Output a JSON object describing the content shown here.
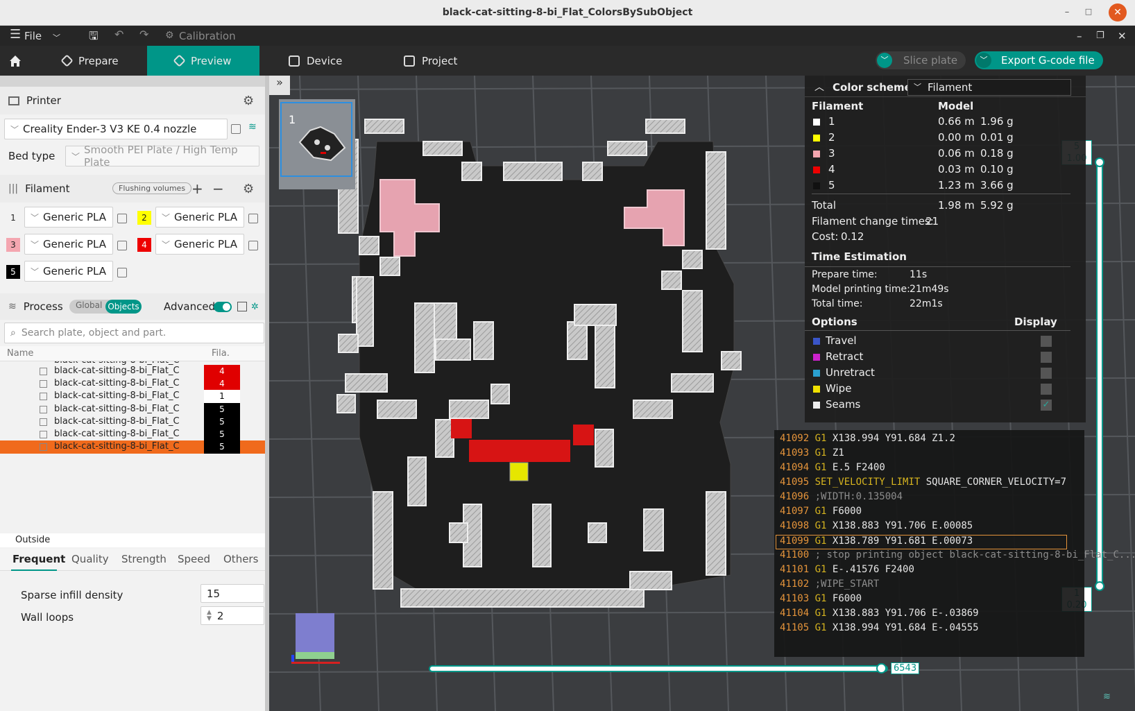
{
  "window": {
    "title": "black-cat-sitting-8-bi_Flat_ColorsBySubObject"
  },
  "menubar": {
    "file": "File",
    "calibration": "Calibration"
  },
  "tabs": [
    {
      "label": "Prepare"
    },
    {
      "label": "Preview"
    },
    {
      "label": "Device"
    },
    {
      "label": "Project"
    }
  ],
  "actions": {
    "slice": "Slice plate",
    "export": "Export G-code file"
  },
  "printer": {
    "header": "Printer",
    "name": "Creality Ender-3 V3 KE 0.4 nozzle",
    "bed_label": "Bed type",
    "bed_value": "Smooth PEI Plate / High Temp Plate"
  },
  "filament": {
    "header": "Filament",
    "flushing": "Flushing volumes",
    "slots": [
      {
        "num": "1",
        "name": "Generic PLA",
        "color": "#ffffff",
        "text_color": "#222222"
      },
      {
        "num": "2",
        "name": "Generic PLA",
        "color": "#ffff00",
        "text_color": "#222222"
      },
      {
        "num": "3",
        "name": "Generic PLA",
        "color": "#f4a6b0",
        "text_color": "#222222"
      },
      {
        "num": "4",
        "name": "Generic PLA",
        "color": "#ee0000",
        "text_color": "#ffffff"
      },
      {
        "num": "5",
        "name": "Generic PLA",
        "color": "#000000",
        "text_color": "#ffffff"
      }
    ]
  },
  "process": {
    "header": "Process",
    "global": "Global",
    "objects": "Objects",
    "advanced": "Advanced",
    "search_placeholder": "Search plate, object and part."
  },
  "object_list": {
    "col_name": "Name",
    "col_fila": "Fila.",
    "rows": [
      {
        "name": "black-cat-sitting-8-bi_Flat_C",
        "fila": "4",
        "color": "#e00000",
        "text": "#ffffff",
        "selected": false
      },
      {
        "name": "black-cat-sitting-8-bi_Flat_C",
        "fila": "4",
        "color": "#e00000",
        "text": "#ffffff",
        "selected": false
      },
      {
        "name": "black-cat-sitting-8-bi_Flat_C",
        "fila": "1",
        "color": "#ffffff",
        "text": "#000000",
        "selected": false
      },
      {
        "name": "black-cat-sitting-8-bi_Flat_C",
        "fila": "5",
        "color": "#000000",
        "text": "#ffffff",
        "selected": false
      },
      {
        "name": "black-cat-sitting-8-bi_Flat_C",
        "fila": "5",
        "color": "#000000",
        "text": "#ffffff",
        "selected": false
      },
      {
        "name": "black-cat-sitting-8-bi_Flat_C",
        "fila": "5",
        "color": "#000000",
        "text": "#ffffff",
        "selected": false
      },
      {
        "name": "black-cat-sitting-8-bi_Flat_C",
        "fila": "5",
        "color": "#000000",
        "text": "#ffffff",
        "selected": true
      }
    ],
    "footer": "Outside"
  },
  "settings_tabs": [
    "Frequent",
    "Quality",
    "Strength",
    "Speed",
    "Others"
  ],
  "settings": [
    {
      "label": "Sparse infill density",
      "value": "15"
    },
    {
      "label": "Wall loops",
      "value": "2"
    }
  ],
  "plate_thumb": {
    "number": "1"
  },
  "legend": {
    "title": "Color scheme",
    "scheme": "Filament",
    "col_filament": "Filament",
    "col_model": "Model",
    "rows": [
      {
        "id": "1",
        "color": "#ffffff",
        "length": "0.66 m",
        "weight": "1.96 g"
      },
      {
        "id": "2",
        "color": "#ffff00",
        "length": "0.00 m",
        "weight": "0.01 g"
      },
      {
        "id": "3",
        "color": "#f4a6b0",
        "length": "0.06 m",
        "weight": "0.18 g"
      },
      {
        "id": "4",
        "color": "#ee0000",
        "length": "0.03 m",
        "weight": "0.10 g"
      },
      {
        "id": "5",
        "color": "#111111",
        "length": "1.23 m",
        "weight": "3.66 g"
      }
    ],
    "total_label": "Total",
    "total_length": "1.98 m",
    "total_weight": "5.92 g",
    "change_label": "Filament change times:",
    "change_value": "21",
    "cost_label": "Cost:",
    "cost_value": "0.12",
    "time_title": "Time Estimation",
    "prepare_label": "Prepare time:",
    "prepare_value": "11s",
    "model_time_label": "Model printing time:",
    "model_time_value": "21m49s",
    "total_time_label": "Total time:",
    "total_time_value": "22m1s",
    "options_title": "Options",
    "display_title": "Display",
    "options": [
      {
        "name": "Travel",
        "color": "#3a55c8",
        "checked": false
      },
      {
        "name": "Retract",
        "color": "#cc22cc",
        "checked": false
      },
      {
        "name": "Unretract",
        "color": "#2aa0d0",
        "checked": false
      },
      {
        "name": "Wipe",
        "color": "#f0e000",
        "checked": false
      },
      {
        "name": "Seams",
        "color": "#eeeeee",
        "checked": true
      }
    ]
  },
  "gcode": [
    {
      "n": "41092",
      "cmd": "G1",
      "args": "X138.994 Y91.684 Z1.2",
      "type": "g"
    },
    {
      "n": "41093",
      "cmd": "G1",
      "args": "Z1",
      "type": "g"
    },
    {
      "n": "41094",
      "cmd": "G1",
      "args": "E.5 F2400",
      "type": "g"
    },
    {
      "n": "41095",
      "cmd": "SET_VELOCITY_LIMIT",
      "args": "SQUARE_CORNER_VELOCITY=7",
      "type": "g"
    },
    {
      "n": "41096",
      "cmd": "",
      "args": ";WIDTH:0.135004",
      "type": "c"
    },
    {
      "n": "41097",
      "cmd": "G1",
      "args": "F6000",
      "type": "g"
    },
    {
      "n": "41098",
      "cmd": "G1",
      "args": "X138.883 Y91.706 E.00085",
      "type": "g"
    },
    {
      "n": "41099",
      "cmd": "G1",
      "args": "X138.789 Y91.681 E.00073",
      "type": "h"
    },
    {
      "n": "41100",
      "cmd": "",
      "args": "; stop printing object black-cat-sitting-8-bi_Flat_C...",
      "type": "c"
    },
    {
      "n": "41101",
      "cmd": "G1",
      "args": "E-.41576 F2400",
      "type": "g"
    },
    {
      "n": "41102",
      "cmd": "",
      "args": ";WIPE_START",
      "type": "c"
    },
    {
      "n": "41103",
      "cmd": "G1",
      "args": "F6000",
      "type": "g"
    },
    {
      "n": "41104",
      "cmd": "G1",
      "args": "X138.883 Y91.706 E-.03869",
      "type": "g"
    },
    {
      "n": "41105",
      "cmd": "G1",
      "args": "X138.994 Y91.684 E-.04555",
      "type": "g"
    }
  ],
  "layer_slider": {
    "top_layer": "5",
    "top_height": "1.00",
    "bottom_layer": "1",
    "bottom_height": "0.20"
  },
  "move_slider": {
    "value": "6543"
  },
  "colors": {
    "accent": "#009688",
    "selection": "#f06a1c"
  }
}
